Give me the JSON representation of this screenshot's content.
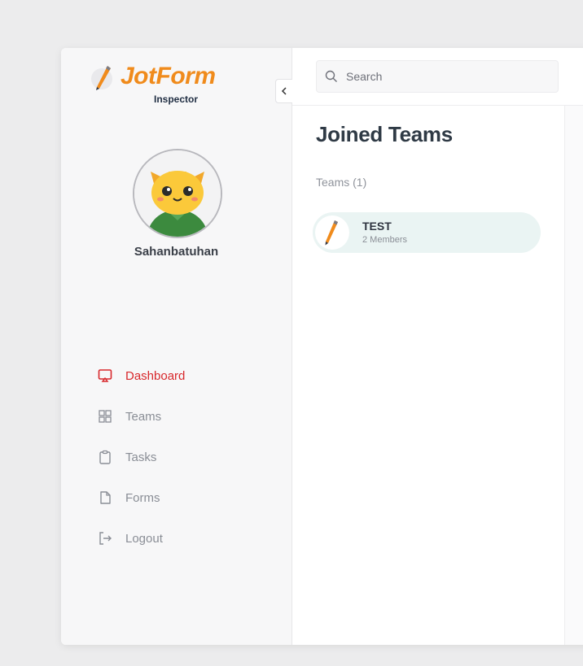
{
  "brand": {
    "name": "JotForm",
    "subtitle": "Inspector",
    "accent": "#f08b1c"
  },
  "sidebar": {
    "username": "Sahanbatuhan",
    "items": [
      {
        "label": "Dashboard",
        "icon": "monitor-icon",
        "active": true
      },
      {
        "label": "Teams",
        "icon": "grid-icon",
        "active": false
      },
      {
        "label": "Tasks",
        "icon": "clipboard-icon",
        "active": false
      },
      {
        "label": "Forms",
        "icon": "file-icon",
        "active": false
      },
      {
        "label": "Logout",
        "icon": "logout-icon",
        "active": false
      }
    ],
    "active_color": "#d8282c"
  },
  "search": {
    "placeholder": "Search"
  },
  "main": {
    "title": "Joined Teams",
    "section_label": "Teams (1)",
    "teams": [
      {
        "name": "TEST",
        "members": "2 Members"
      }
    ]
  }
}
